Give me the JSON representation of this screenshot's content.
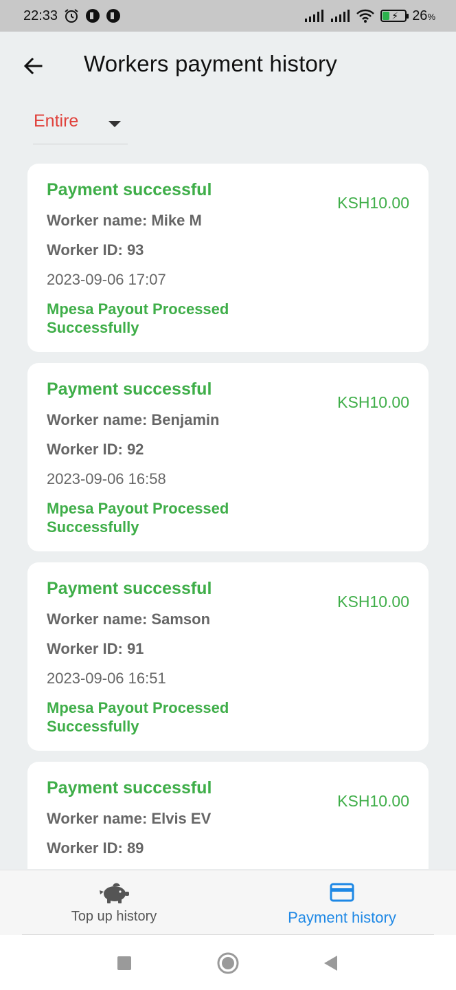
{
  "status_bar": {
    "time": "22:33",
    "battery_percent": "26",
    "battery_suffix": "%",
    "icons": [
      "alarm-icon",
      "app-notification-icon",
      "app-notification-icon",
      "signal-icon",
      "signal-icon",
      "wifi-icon",
      "battery-charging-icon"
    ]
  },
  "header": {
    "title": "Workers payment history",
    "back_icon": "arrow-left-icon"
  },
  "filter": {
    "selected": "Entire"
  },
  "payments": [
    {
      "status": "Payment successful",
      "amount": "KSH10.00",
      "worker_name": "Worker name: Mike M",
      "worker_id": "Worker ID: 93",
      "date": "2023-09-06 17:07",
      "message": "Mpesa Payout Processed Successfully"
    },
    {
      "status": "Payment successful",
      "amount": "KSH10.00",
      "worker_name": "Worker name: Benjamin",
      "worker_id": "Worker ID: 92",
      "date": "2023-09-06 16:58",
      "message": "Mpesa Payout Processed Successfully"
    },
    {
      "status": "Payment successful",
      "amount": "KSH10.00",
      "worker_name": "Worker name: Samson",
      "worker_id": "Worker ID: 91",
      "date": "2023-09-06 16:51",
      "message": "Mpesa Payout Processed Successfully"
    },
    {
      "status": "Payment successful",
      "amount": "KSH10.00",
      "worker_name": "Worker name: Elvis EV",
      "worker_id": "Worker ID: 89",
      "date": "",
      "message": ""
    }
  ],
  "bottom_nav": {
    "items": [
      {
        "label": "Top up history",
        "icon": "piggy-bank-icon",
        "active": false
      },
      {
        "label": "Payment history",
        "icon": "credit-card-icon",
        "active": true
      }
    ]
  },
  "colors": {
    "success_green": "#3fae49",
    "filter_red": "#e0403a",
    "active_blue": "#1e88e5",
    "background": "#eceff0"
  }
}
